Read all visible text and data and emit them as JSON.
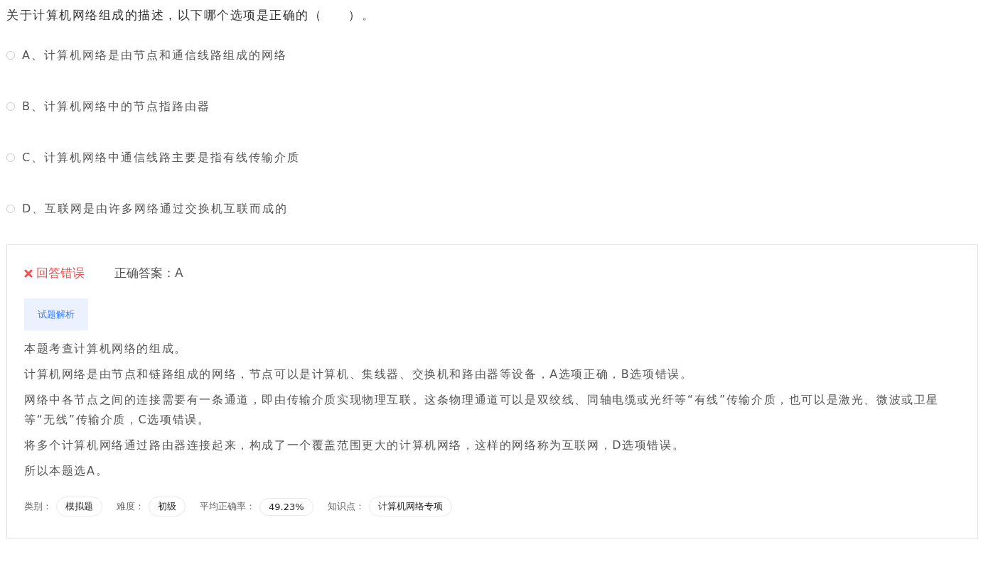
{
  "question": "关于计算机网络组成的描述，以下哪个选项是正确的（　　）。",
  "options": [
    {
      "letter": "A、",
      "text": "计算机网络是由节点和通信线路组成的网络",
      "selected": false
    },
    {
      "letter": "B、",
      "text": "计算机网络中的节点指路由器",
      "selected": false
    },
    {
      "letter": "C、",
      "text": "计算机网络中通信线路主要是指有线传输介质",
      "selected": false
    },
    {
      "letter": "D、",
      "text": "互联网是由许多网络通过交换机互联而成的",
      "selected": false
    }
  ],
  "result": {
    "kind": "wrong",
    "label": "回答错误",
    "answer_label": "正确答案：",
    "answer": "A"
  },
  "analysis_tab": {
    "label": "试题解析",
    "selected": true
  },
  "analysis": [
    "本题考查计算机网络的组成。",
    "计算机网络是由节点和链路组成的网络，节点可以是计算机、集线器、交换机和路由器等设备，A选项正确，B选项错误。",
    "网络中各节点之间的连接需要有一条通道，即由传输介质实现物理互联。这条物理通道可以是双绞线、同轴电缆或光纤等“有线”传输介质，也可以是激光、微波或卫星等“无线”传输介质，C选项错误。",
    "将多个计算机网络通过路由器连接起来，构成了一个覆盖范围更大的计算机网络，这样的网络称为互联网，D选项错误。",
    "所以本题选A。"
  ],
  "meta": [
    {
      "label": "类别：",
      "value": "模拟题"
    },
    {
      "label": "难度：",
      "value": "初级"
    },
    {
      "label": "平均正确率：",
      "value": "49.23%"
    },
    {
      "label": "知识点：",
      "value": "计算机网络专项"
    }
  ]
}
